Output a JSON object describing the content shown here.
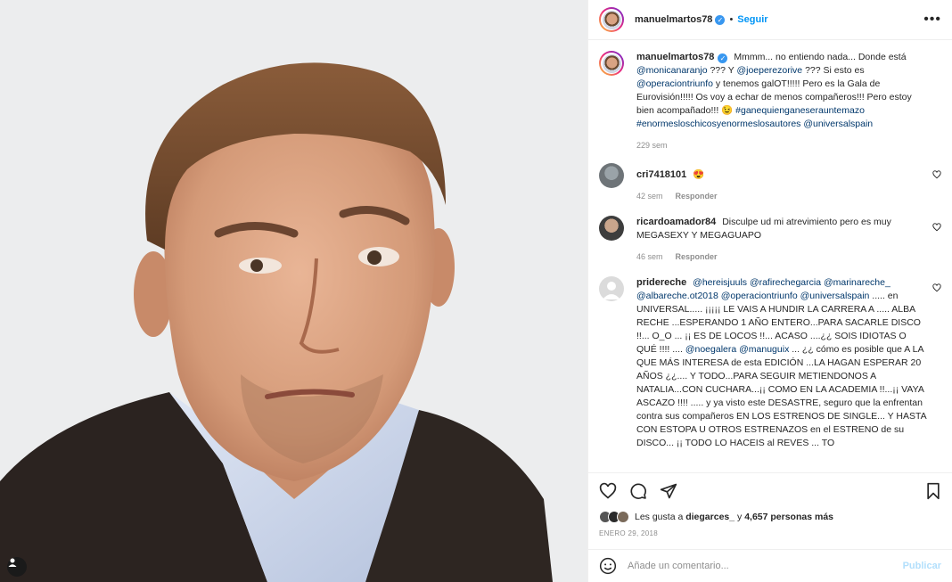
{
  "header": {
    "username": "manuelmartos78",
    "verified_badge": "✓",
    "separator": "•",
    "follow_label": "Seguir",
    "more_icon": "•••"
  },
  "caption": {
    "username": "manuelmartos78",
    "text_1": "Mmmm... no entiendo nada... Donde está",
    "mention_1": "@monicanaranjo",
    "text_2": " ??? Y ",
    "mention_2": "@joeperezorive",
    "text_3": " ??? Si esto es",
    "mention_3": "@operaciontriunfo",
    "text_4": " y tenemos galOT!!!!! Pero es la Gala de Eurovisión!!!!! Os voy a echar de menos compañeros!!! Pero estoy bien acompañado!!! 😉 ",
    "hashtag_1": "#ganequienganeserauntemazo",
    "hashtag_2": "#enormesloschicosyenormeslosautores",
    "mention_4": "@universalspain",
    "time": "229 sem"
  },
  "comments": [
    {
      "username": "cri7418101",
      "text": "😍",
      "time": "42 sem",
      "reply": "Responder"
    },
    {
      "username": "ricardoamador84",
      "text": "Disculpe ud mi atrevimiento pero es muy MEGASEXY Y MEGAGUAPO",
      "time": "46 sem",
      "reply": "Responder"
    },
    {
      "username": "pridereche",
      "mentions_1": "@hereisjuuls @rafirechegarcia @marinareche_ @albareche.ot2018 @operaciontriunfo @universalspain",
      "text_1": " ..... en UNIVERSAL..... ¡¡¡¡¡ LE VAIS A HUNDIR LA CARRERA A ..... ALBA RECHE ...ESPERANDO 1 AÑO ENTERO...PARA SACARLE DISCO !!... O_O ... ¡¡ ES DE LOCOS !!... ACASO ....¿¿ SOIS IDIOTAS O QUÉ !!!! .... ",
      "mentions_2": "@noegalera @manuguix",
      "text_2": " ... ¿¿ cómo es posible que A LA QUE MÁS INTERESA de esta EDICIÓN ...LA HAGAN ESPERAR 20 AÑOS ¿¿.... Y TODO...PARA SEGUIR METIENDONOS A NATALIA...CON CUCHARA...¡¡ COMO EN LA ACADEMIA !!...¡¡ VAYA ASCAZO !!!! ..... y ya visto este DESASTRE, seguro que la enfrentan contra sus compañeros EN LOS ESTRENOS DE SINGLE... Y HASTA CON ESTOPA U OTROS ESTRENAZOS en el ESTRENO de su DISCO... ¡¡ TODO LO HACEIS al REVES ... TO"
    }
  ],
  "likes": {
    "prefix": "Les gusta a",
    "user": "diegarces_",
    "connector": "y",
    "count": "4,657 personas más"
  },
  "date": "ENERO 29, 2018",
  "add_comment": {
    "placeholder": "Añade un comentario...",
    "publish": "Publicar"
  }
}
